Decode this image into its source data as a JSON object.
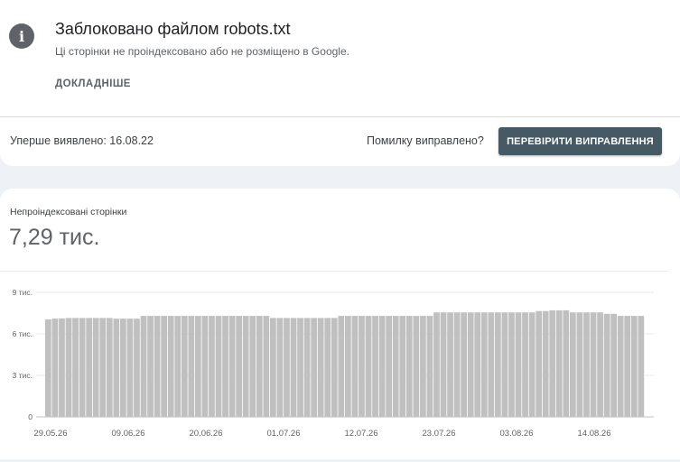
{
  "issue": {
    "title": "Заблоковано файлом robots.txt",
    "subtitle": "Ці сторінки не проіндексовано або не розміщено в Google.",
    "details_label": "ДОКЛАДНІШЕ",
    "icon": "info-icon"
  },
  "status": {
    "first_detected": "Уперше виявлено: 16.08.22",
    "fixed_question": "Помилку виправлено?",
    "validate_label": "ПЕРЕВІРИТИ ВИПРАВЛЕННЯ"
  },
  "metric": {
    "label": "Непроіндексовані сторінки",
    "value": "7,29 тис."
  },
  "colors": {
    "bar": "#c0c0c0",
    "button": "#455a64",
    "background": "#eef1f5"
  },
  "chart_data": {
    "type": "bar",
    "y_ticks": [
      "9 тис.",
      "6 тис.",
      "3 тис.",
      "0"
    ],
    "y_tick_values": [
      9000,
      6000,
      3000,
      0
    ],
    "ylim": [
      0,
      9000
    ],
    "x_tick_labels": [
      "29.05.26",
      "09.06.26",
      "20.06.26",
      "01.07.26",
      "12.07.26",
      "23.07.26",
      "03.08.26",
      "14.08.26"
    ],
    "values": [
      7050,
      7100,
      7120,
      7150,
      7150,
      7150,
      7150,
      7150,
      7150,
      7150,
      7100,
      7100,
      7100,
      7100,
      7300,
      7300,
      7300,
      7300,
      7300,
      7300,
      7300,
      7300,
      7300,
      7300,
      7300,
      7300,
      7300,
      7300,
      7300,
      7300,
      7300,
      7300,
      7300,
      7150,
      7150,
      7150,
      7150,
      7150,
      7150,
      7150,
      7150,
      7150,
      7150,
      7300,
      7300,
      7300,
      7300,
      7300,
      7300,
      7300,
      7300,
      7300,
      7300,
      7300,
      7300,
      7300,
      7300,
      7550,
      7550,
      7550,
      7550,
      7550,
      7550,
      7550,
      7550,
      7550,
      7550,
      7550,
      7550,
      7550,
      7550,
      7550,
      7650,
      7650,
      7700,
      7700,
      7700,
      7550,
      7550,
      7550,
      7550,
      7550,
      7450,
      7450,
      7300,
      7300,
      7300,
      7300
    ],
    "grid": true
  }
}
